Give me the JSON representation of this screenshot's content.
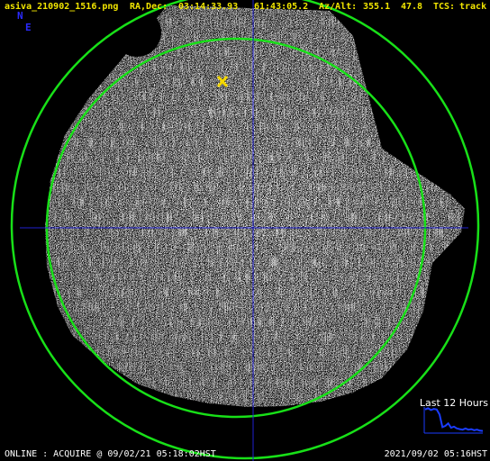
{
  "header": {
    "filename": "asiva_210902_1516.png",
    "radec_label": "RA,Dec:",
    "ra": "03:14:33.93",
    "dec": "61:43:05.2",
    "azalt_label": "Az/Alt:",
    "az": "355.1",
    "alt": "47.8",
    "tcs_label": "TCS:",
    "tcs_state": "track"
  },
  "compass": {
    "north": "N",
    "east": "E"
  },
  "footer": {
    "status": "ONLINE : ACQUIRE @ 09/02/21 05:18:02HST",
    "timestamp": "2021/09/02 05:16HST"
  },
  "trend": {
    "title": "Last 12 Hours",
    "values": [
      0.9,
      0.95,
      0.88,
      0.92,
      0.9,
      0.7,
      0.2,
      0.25,
      0.35,
      0.18,
      0.22,
      0.15,
      0.12,
      0.1,
      0.15,
      0.1,
      0.12,
      0.08,
      0.1,
      0.06,
      0.05
    ]
  },
  "marker": {
    "icon": "target-x-icon"
  },
  "colors": {
    "header_text": "#f2e600",
    "compass_text": "#2a2aff",
    "circle": "#18e018",
    "crosshair": "#2020d0",
    "marker": "#f5d800",
    "trend_line": "#1a3cff",
    "footer_text": "#ffffff"
  }
}
